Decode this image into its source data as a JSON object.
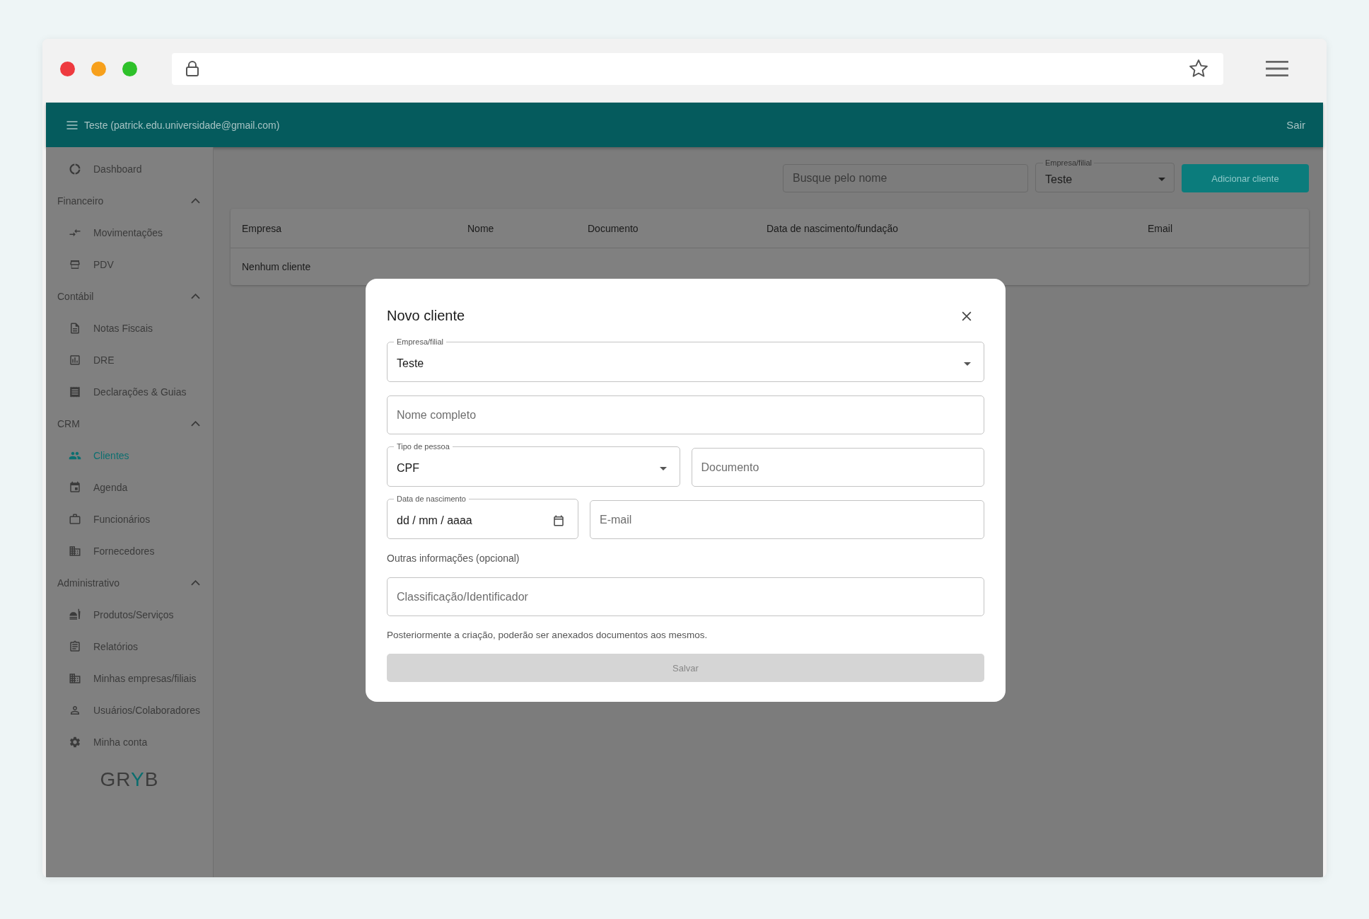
{
  "header": {
    "user": "Teste (patrick.edu.universidade@gmail.com)",
    "logout": "Sair"
  },
  "sidebar": {
    "items": [
      {
        "kind": "link",
        "label": "Dashboard",
        "selected": false
      },
      {
        "kind": "section",
        "label": "Financeiro",
        "expanded": true,
        "children": [
          {
            "kind": "link",
            "label": "Movimentações",
            "selected": false
          },
          {
            "kind": "link",
            "label": "PDV",
            "selected": false
          }
        ]
      },
      {
        "kind": "section",
        "label": "Contábil",
        "expanded": true,
        "children": [
          {
            "kind": "link",
            "label": "Notas Fiscais",
            "selected": false
          },
          {
            "kind": "link",
            "label": "DRE",
            "selected": false
          },
          {
            "kind": "link",
            "label": "Declarações & Guias",
            "selected": false
          }
        ]
      },
      {
        "kind": "section",
        "label": "CRM",
        "expanded": true,
        "children": [
          {
            "kind": "link",
            "label": "Clientes",
            "selected": true
          },
          {
            "kind": "link",
            "label": "Agenda",
            "selected": false
          },
          {
            "kind": "link",
            "label": "Funcionários",
            "selected": false
          },
          {
            "kind": "link",
            "label": "Fornecedores",
            "selected": false
          }
        ]
      },
      {
        "kind": "section",
        "label": "Administrativo",
        "expanded": true,
        "children": [
          {
            "kind": "link",
            "label": "Produtos/Serviços",
            "selected": false
          },
          {
            "kind": "link",
            "label": "Relatórios",
            "selected": false
          },
          {
            "kind": "link",
            "label": "Minhas empresas/filiais",
            "selected": false
          },
          {
            "kind": "link",
            "label": "Usuários/Colaboradores",
            "selected": false
          },
          {
            "kind": "link",
            "label": "Minha conta",
            "selected": false
          }
        ]
      }
    ],
    "logo": [
      {
        "text": "GR",
        "accent": false
      },
      {
        "text": "Y",
        "accent": true
      },
      {
        "text": "B",
        "accent": false
      }
    ]
  },
  "toolbar": {
    "search": {
      "placeholder": "Busque pelo nome"
    },
    "company_select": {
      "label": "Empresa/filial",
      "value": "Teste"
    },
    "add_button": "Adicionar cliente"
  },
  "table": {
    "columns": [
      "Empresa",
      "Nome",
      "Documento",
      "Data de nascimento/fundação",
      "Email"
    ],
    "empty_message": "Nenhum cliente"
  },
  "dialog": {
    "title": "Novo cliente",
    "rows": [
      [
        {
          "kind": "select",
          "label": "Empresa/filial",
          "value": "Teste"
        }
      ],
      [
        {
          "kind": "text",
          "placeholder": "Nome completo"
        }
      ],
      [
        {
          "kind": "select",
          "label": "Tipo de pessoa",
          "value": "CPF"
        },
        {
          "kind": "text",
          "placeholder": "Documento"
        }
      ],
      [
        {
          "kind": "date",
          "label": "Data de nascimento",
          "placeholder": "dd / mm / aaaa"
        },
        {
          "kind": "text",
          "placeholder": "E-mail"
        }
      ]
    ],
    "section_label": "Outras informações (opcional)",
    "extra_fields": [
      {
        "kind": "text",
        "placeholder": "Classificação/Identificador"
      }
    ],
    "note": "Posteriormente a criação, poderão ser anexados documentos aos mesmos.",
    "save_button": {
      "label": "Salvar",
      "disabled": true
    }
  }
}
